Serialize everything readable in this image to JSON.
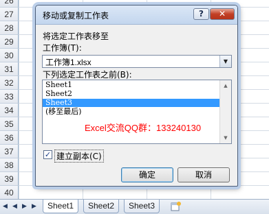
{
  "sheet": {
    "rows": [
      "26",
      "27",
      "28",
      "29",
      "30",
      "31",
      "32",
      "33",
      "34",
      "35",
      "36",
      "37",
      "38",
      "39",
      "40",
      "41"
    ]
  },
  "tabs": {
    "items": [
      "Sheet1",
      "Sheet2",
      "Sheet3"
    ],
    "active_index": 0
  },
  "dialog": {
    "title": "移动或复制工作表",
    "help_label": "?",
    "close_label": "✕",
    "move_to_label": "将选定工作表移至",
    "workbook_label": "工作簿(T):",
    "workbook_value": "工作簿1.xlsx",
    "before_label": "下列选定工作表之前(B):",
    "list_items": [
      "Sheet1",
      "Sheet2",
      "Sheet3",
      "(移至最后)"
    ],
    "selected_index": 2,
    "watermark": "Excel交流QQ群：133240130",
    "copy_label": "建立副本(C)",
    "copy_checked": true,
    "ok_label": "确定",
    "cancel_label": "取消"
  },
  "icons": {
    "title_close": "close-icon",
    "combo": "chevron-down-icon",
    "scroll_up": "scroll-up-icon",
    "scroll_down": "scroll-down-icon",
    "check": "checkmark-icon",
    "new_sheet": "insert-worksheet-icon"
  },
  "colors": {
    "selection": "#3399ff",
    "watermark": "#ff0000",
    "close_button": "#c23f25"
  }
}
